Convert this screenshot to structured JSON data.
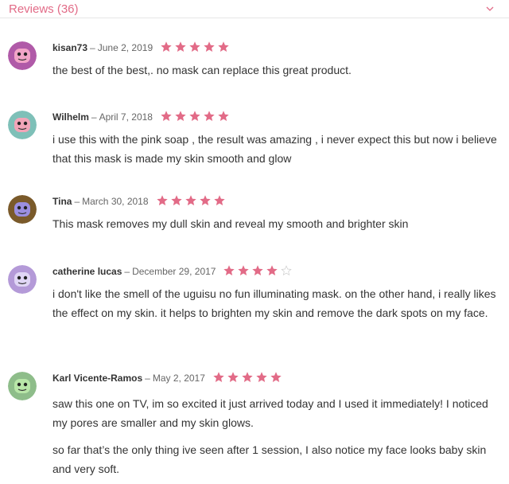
{
  "header": {
    "title": "Reviews (36)",
    "chevron_icon": "chevron-down-icon"
  },
  "colors": {
    "accent": "#e26b87",
    "star_filled": "#e26b87",
    "star_empty": "#dddddd"
  },
  "reviews": [
    {
      "author": "kisan73",
      "date": "June 2, 2019",
      "rating": 5,
      "avatar_icon": "pig-avatar-icon",
      "avatar_color": "#b05aa8",
      "paragraphs": [
        "the best of the best,. no mask can replace this great product."
      ]
    },
    {
      "author": "Wilhelm",
      "date": "April 7, 2018",
      "rating": 5,
      "avatar_icon": "robot-avatar-icon",
      "avatar_color": "#7ec0b8",
      "paragraphs": [
        "i use this with the pink soap , the result was amazing , i never expect this but now i believe that this mask is made my skin smooth and glow"
      ]
    },
    {
      "author": "Tina",
      "date": "March 30, 2018",
      "rating": 5,
      "avatar_icon": "monster-avatar-icon",
      "avatar_color": "#7a5a2a",
      "paragraphs": [
        "This mask removes my dull skin and reveal my smooth and brighter skin"
      ]
    },
    {
      "author": "catherine lucas",
      "date": "December 29, 2017",
      "rating": 4,
      "avatar_icon": "alien-avatar-icon",
      "avatar_color": "#b49ad8",
      "paragraphs": [
        "i don't like the smell of the uguisu no fun illuminating mask. on the other hand, i really likes the effect on my skin. it helps to brighten my skin and remove the dark spots on my face."
      ]
    },
    {
      "author": "Karl Vicente-Ramos",
      "date": "May 2, 2017",
      "rating": 5,
      "avatar_icon": "frankenstein-avatar-icon",
      "avatar_color": "#8ebd8a",
      "paragraphs": [
        "saw this one on TV, im so excited it just arrived today and I used it immediately! I noticed my pores are smaller and my skin glows.",
        "so far that’s the only thing ive seen after 1 session, I also notice my face looks baby skin and very soft."
      ]
    }
  ]
}
